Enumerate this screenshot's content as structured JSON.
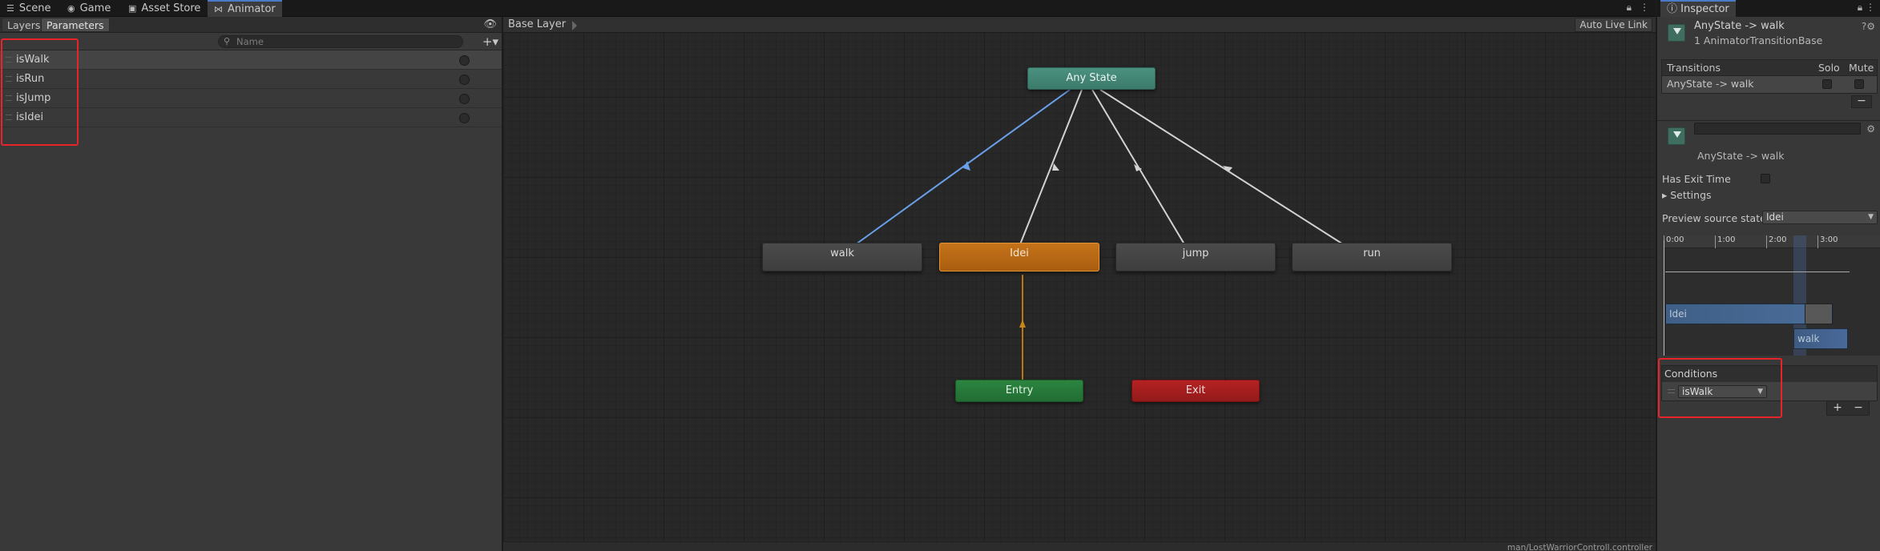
{
  "tabs": [
    {
      "label": "Scene",
      "icon": "scene-icon"
    },
    {
      "label": "Game",
      "icon": "gamepad-icon"
    },
    {
      "label": "Asset Store",
      "icon": "store-icon"
    },
    {
      "label": "Animator",
      "icon": "animator-icon",
      "active": true
    }
  ],
  "left_panel": {
    "subtabs": [
      "Layers",
      "Parameters"
    ],
    "selected_subtab": "Parameters",
    "search_placeholder": "Name",
    "parameters": [
      "isWalk",
      "isRun",
      "isJump",
      "isIdei"
    ]
  },
  "graph": {
    "breadcrumb": "Base Layer",
    "auto_live_link": "Auto Live Link",
    "states": {
      "any_state": "Any State",
      "walk": "walk",
      "idei": "Idei",
      "jump": "jump",
      "run": "run",
      "entry": "Entry",
      "exit": "Exit"
    },
    "controller_path": "man/LostWarriorControll.controller"
  },
  "inspector": {
    "tab_label": "Inspector",
    "title": "AnyState -> walk",
    "subtitle": "1 AnimatorTransitionBase",
    "transitions_header": "Transitions",
    "solo_label": "Solo",
    "mute_label": "Mute",
    "transition_row": "AnyState -> walk",
    "minus": "−",
    "transition_name": "AnyState -> walk",
    "has_exit_time": "Has Exit Time",
    "settings": "Settings",
    "preview_label": "Preview source state",
    "preview_value": "Idei",
    "timeline_ticks": [
      "0:00",
      "1:00",
      "2:00",
      "3:00"
    ],
    "bar_idei": "Idei",
    "bar_walk": "walk",
    "conditions_header": "Conditions",
    "condition_param": "isWalk",
    "plus": "+",
    "minus2": "−"
  },
  "colors": {
    "accent_blue": "#4a7ac8",
    "highlight_red": "#e8242a",
    "state_orange": "#c6731a",
    "any_state_teal": "#4a9180",
    "entry_green": "#2c8540",
    "exit_red": "#b52222"
  }
}
